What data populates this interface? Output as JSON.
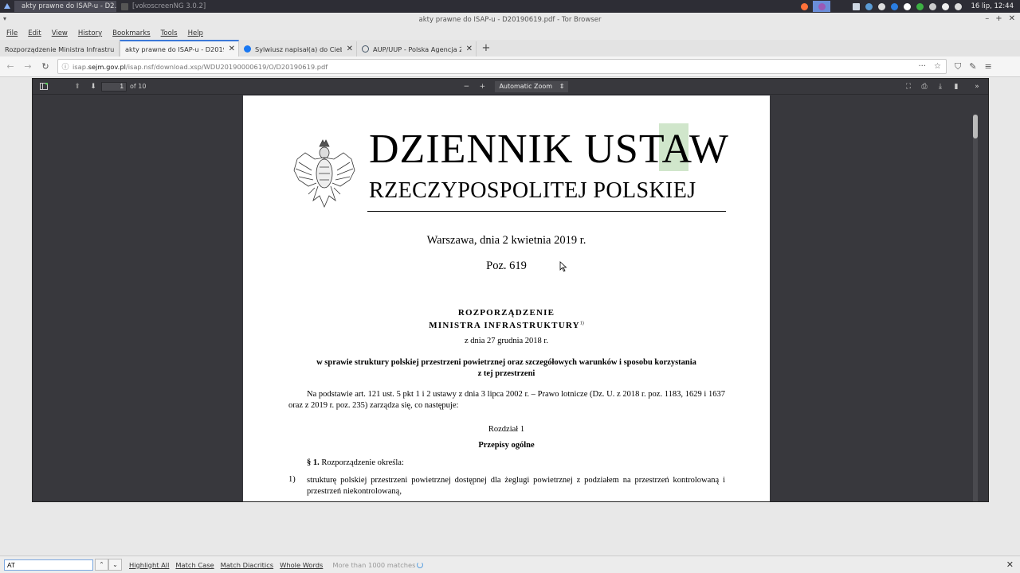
{
  "taskbar": {
    "tasks": [
      {
        "label": "akty prawne do ISAP-u - D2..."
      },
      {
        "label": "[vokoscreenNG 3.0.2]"
      }
    ],
    "clock": "16 lip, 12:44"
  },
  "window": {
    "title": "akty prawne do ISAP-u - D20190619.pdf - Tor Browser"
  },
  "menubar": {
    "items": [
      "File",
      "Edit",
      "View",
      "History",
      "Bookmarks",
      "Tools",
      "Help"
    ]
  },
  "tabs": [
    {
      "label": "Rozporządzenie Ministra Infrastru",
      "active": false
    },
    {
      "label": "akty prawne do ISAP-u - D201906",
      "active": true
    },
    {
      "label": "Sylwiusz napisał(a) do Ciebie",
      "active": false
    },
    {
      "label": "AUP/UUP - Polska Agencja Że",
      "active": false
    }
  ],
  "navbar": {
    "url_domain_prefix": "isap.",
    "url_domain": "sejm.gov.pl",
    "url_path": "/isap.nsf/download.xsp/WDU20190000619/O/D20190619.pdf"
  },
  "pdf_toolbar": {
    "page_number": "1",
    "page_total": "of 10",
    "zoom": "Automatic Zoom"
  },
  "document": {
    "masthead_line1": "DZIENNIK USTAW",
    "masthead_line2": "RZECZYPOSPOLITEJ POLSKIEJ",
    "date": "Warszawa, dnia 2 kwietnia 2019 r.",
    "position": "Poz. 619",
    "act_type": "ROZPORZĄDZENIE",
    "issuer": "MINISTRA INFRASTRUKTURY",
    "footnote_mark": "1)",
    "act_date": "z dnia 27 grudnia 2018 r.",
    "subject_line1": "w sprawie struktury polskiej przestrzeni powietrznej oraz szczegółowych warunków i sposobu korzystania",
    "subject_line2": "z tej przestrzeni",
    "legal_basis": "Na podstawie art. 121 ust. 5 pkt 1 i 2 ustawy z dnia 3 lipca 2002 r. – Prawo lotnicze (Dz. U. z 2018 r. poz. 1183, 1629 i 1637 oraz z 2019 r. poz. 235) zarządza się, co następuje:",
    "chapter": "Rozdział 1",
    "chapter_title": "Przepisy ogólne",
    "par1_mark": "§ 1.",
    "par1_text": " Rozporządzenie określa:",
    "item1_num": "1)",
    "item1_text": "strukturę polskiej przestrzeni powietrznej dostępnej dla żeglugi powietrznej z podziałem na przestrzeń kontrolowaną i przestrzeń niekontrolowaną,"
  },
  "findbar": {
    "query": "AT",
    "highlight_all": "Highlight All",
    "match_case": "Match Case",
    "match_diacritics": "Match Diacritics",
    "whole_words": "Whole Words",
    "matches": "More than 1000 matches"
  },
  "colors": {
    "accent": "#3b78d8",
    "highlight": "#96c88c",
    "pdf_background": "#38383d"
  }
}
